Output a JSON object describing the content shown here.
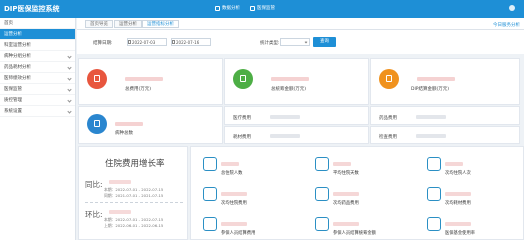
{
  "app": {
    "title": "DIP医保监控系统"
  },
  "topnav": [
    {
      "label": "数据分析"
    },
    {
      "label": "医保监管"
    }
  ],
  "user": {
    "name": ""
  },
  "sidebar": {
    "items": [
      {
        "label": "首页"
      },
      {
        "label": "运营分析"
      },
      {
        "label": "科室运营分析"
      },
      {
        "label": "病种分组分析"
      },
      {
        "label": "药品耗材分析"
      },
      {
        "label": "医师绩效分析"
      },
      {
        "label": "医保监管"
      },
      {
        "label": "质控管理"
      },
      {
        "label": "系统设置"
      }
    ]
  },
  "tabs": [
    {
      "label": "首页导览"
    },
    {
      "label": "运营分析"
    },
    {
      "label": "运营指标分析"
    }
  ],
  "tabs_right_link": "今日服务分析",
  "filter": {
    "date_label": "结算日期:",
    "date_start": "2022-07-03",
    "date_end": "2022-07-16",
    "type_label": "统计类型:",
    "type_value": "",
    "search_button": "查询"
  },
  "summary_cards": [
    {
      "caption": "总费用(万元)",
      "color": "#e8563e",
      "icon": "yuan-icon"
    },
    {
      "caption": "总统筹金额(万元)",
      "color": "#4dae45",
      "icon": "yuan-icon"
    },
    {
      "caption": "DIP结算金额(万元)",
      "color": "#f0921e",
      "icon": "yuan-icon"
    },
    {
      "caption": "病种总数",
      "color": "#2a86cf",
      "icon": "report-icon"
    }
  ],
  "mini_stats": [
    {
      "label": "医疗费用"
    },
    {
      "label": "药品费用"
    },
    {
      "label": "耗材费用"
    },
    {
      "label": "检查费用"
    }
  ],
  "growth": {
    "title": "住院费用增长率",
    "yoy_label": "同比:",
    "yoy_range_1": "本期：2022-07-01 - 2022-07-15",
    "yoy_range_2": "同期：2021-07-01 - 2021-07-15",
    "mom_label": "环比:",
    "mom_range_1": "本期：2022-07-01 - 2022-07-15",
    "mom_range_2": "上期：2022-06-01 - 2022-06-15"
  },
  "stat_cells": [
    {
      "caption": "总住院人数",
      "icon": "patients-icon"
    },
    {
      "caption": "平均住院天数",
      "icon": "home-icon"
    },
    {
      "caption": "次均住院人次",
      "icon": "users-icon"
    },
    {
      "caption": "次均住院费用",
      "icon": "money-bag-icon"
    },
    {
      "caption": "次均药品费用",
      "icon": "coin-icon"
    },
    {
      "caption": "次均耗材费用",
      "icon": "wallet-icon"
    },
    {
      "caption": "参保人员结算费用",
      "icon": "card-icon"
    },
    {
      "caption": "参保人员结算统筹金额",
      "icon": "document-icon"
    },
    {
      "caption": "医保基金使用率",
      "icon": "chart-icon"
    }
  ]
}
